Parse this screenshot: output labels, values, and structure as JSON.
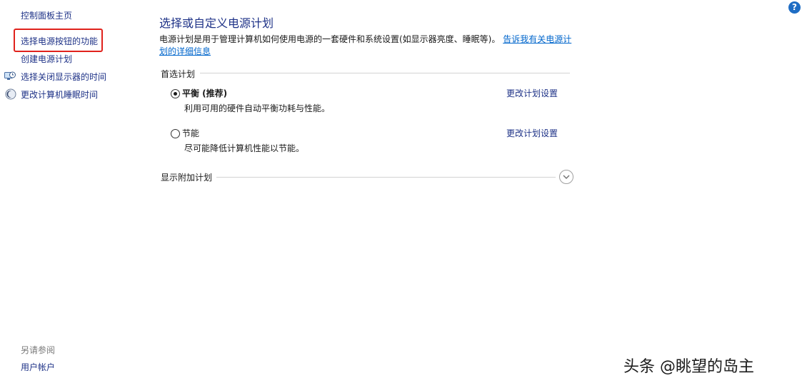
{
  "nav": {
    "home": "控制面板主页",
    "power_buttons": "选择电源按钮的功能",
    "create_plan": "创建电源计划",
    "display_off": "选择关闭显示器的时间",
    "sleep": "更改计算机睡眠时间",
    "see_also": "另请参阅",
    "user_accounts": "用户帐户"
  },
  "help": {
    "label": "?"
  },
  "main": {
    "title": "选择或自定义电源计划",
    "description": "电源计划是用于管理计算机如何使用电源的一套硬件和系统设置(如显示器亮度、睡眠等)。",
    "description_link": "告诉我有关电源计划的详细信息",
    "preferred_header": "首选计划",
    "plans": [
      {
        "name": "平衡 (推荐)",
        "description": "利用可用的硬件自动平衡功耗与性能。",
        "change_link": "更改计划设置",
        "selected": true
      },
      {
        "name": "节能",
        "description": "尽可能降低计算机性能以节能。",
        "change_link": "更改计划设置",
        "selected": false
      }
    ],
    "show_more_header": "显示附加计划"
  },
  "watermark": "头条 @眺望的岛主",
  "colors": {
    "link": "#1e3287",
    "highlight": "#e0221c",
    "help": "#1f6dc4"
  }
}
